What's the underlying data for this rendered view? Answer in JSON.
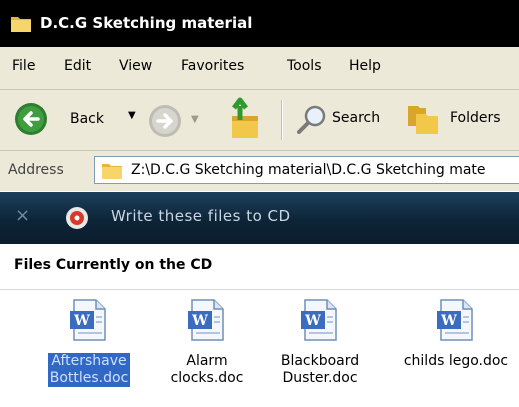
{
  "window": {
    "title": "D.C.G Sketching material"
  },
  "menu": {
    "items": [
      "File",
      "Edit",
      "View",
      "Favorites",
      "Tools",
      "Help"
    ]
  },
  "toolbar": {
    "back_label": "Back",
    "search_label": "Search",
    "folders_label": "Folders"
  },
  "address": {
    "label": "Address",
    "path": "Z:\\D.C.G Sketching material\\D.C.G Sketching mate"
  },
  "cd_task": {
    "close_glyph": "×",
    "text": "Write these files to CD"
  },
  "files_section": {
    "header": "Files Currently on the CD",
    "files": [
      {
        "line1": "Aftershave",
        "line2": "Bottles.doc",
        "selected": true,
        "icon": "word-doc-icon"
      },
      {
        "line1": "Alarm",
        "line2": "clocks.doc",
        "selected": false,
        "icon": "word-doc-icon"
      },
      {
        "line1": "Blackboard",
        "line2": "Duster.doc",
        "selected": false,
        "icon": "word-doc-icon"
      },
      {
        "line1": "childs lego.doc",
        "line2": "",
        "selected": false,
        "icon": "word-doc-icon"
      }
    ]
  },
  "colors": {
    "title_bar": "#000000",
    "chrome": "#ece9d8",
    "banner": "#0d2437",
    "selection": "#3168c6"
  }
}
